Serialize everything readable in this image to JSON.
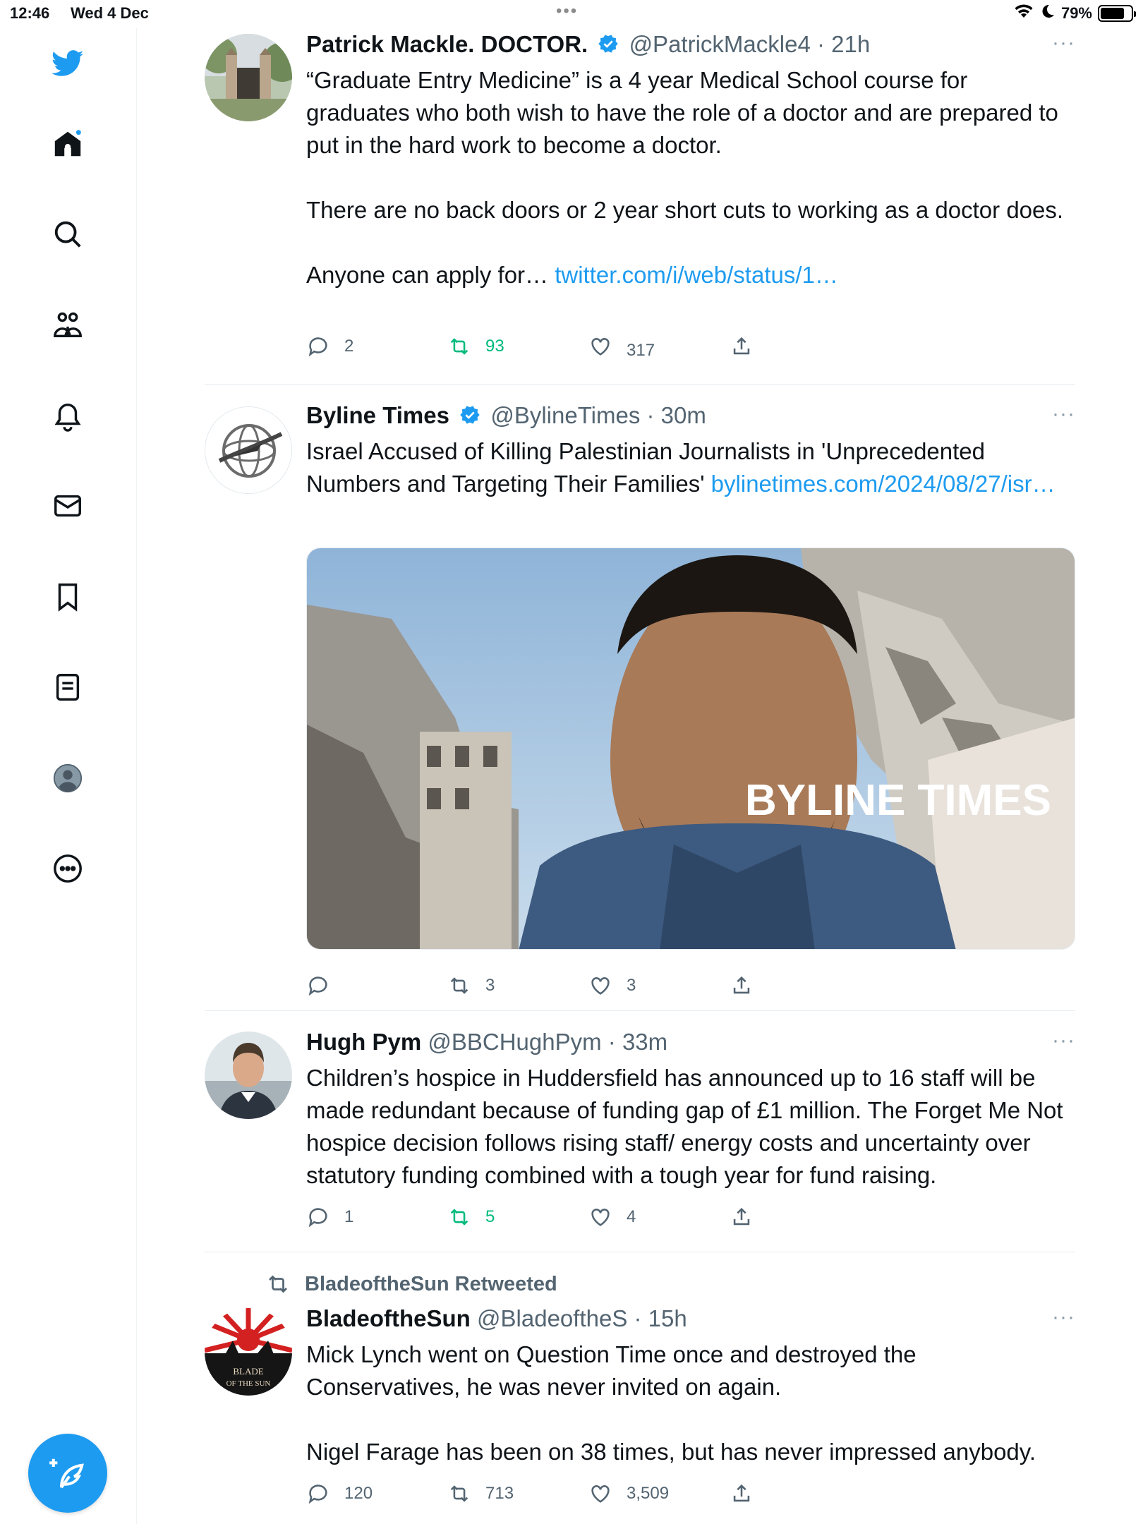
{
  "status_bar": {
    "time": "12:46",
    "date": "Wed 4 Dec",
    "battery": "79%",
    "battery_level": 0.79
  },
  "sidebar": {
    "icons": [
      "twitter-logo-icon",
      "home-icon",
      "search-icon",
      "communities-icon",
      "notifications-icon",
      "messages-icon",
      "bookmarks-icon",
      "lists-icon",
      "profile-icon",
      "more-icon"
    ],
    "compose_icon": "compose-tweet-icon",
    "accent": "#1d9bf0",
    "home_notification_dot": true
  },
  "tweets": [
    {
      "name": "Patrick Mackle. DOCTOR.",
      "verified": true,
      "handle": "@PatrickMackle4",
      "sep": "·",
      "time": "21h",
      "more": "···",
      "paragraphs": [
        "“Graduate Entry Medicine” is a 4 year Medical School course for graduates who both wish to have the role of a doctor and are prepared to put in the hard work to become a doctor.",
        "There are no back doors or 2 year short cuts to working as a doctor does.",
        "Anyone can apply for…"
      ],
      "link": "twitter.com/i/web/status/1…",
      "replies": "2",
      "retweets": "93",
      "likes": "317",
      "retweeted_by_me": true
    },
    {
      "name": "Byline Times",
      "verified": true,
      "handle": "@BylineTimes",
      "sep": "·",
      "time": "30m",
      "more": "···",
      "text": "Israel Accused of Killing Palestinian Journalists in 'Unprecedented Numbers and Targeting Their Families'",
      "link": "bylinetimes.com/2024/08/27/isr…",
      "media_watermark": "BYLINE TIMES",
      "replies": "",
      "retweets": "3",
      "likes": "3"
    },
    {
      "name": "Hugh Pym",
      "verified": false,
      "handle": "@BBCHughPym",
      "sep": "·",
      "time": "33m",
      "more": "···",
      "text": "Children’s hospice in Huddersfield has announced up to 16 staff will be made redundant because of funding gap of £1 million.  The Forget Me Not hospice decision follows rising staff/ energy costs and uncertainty over statutory funding combined with a tough year for fund raising.",
      "replies": "1",
      "retweets": "5",
      "likes": "4",
      "retweeted_by_me": true
    },
    {
      "retweet_context": "BladeoftheSun Retweeted",
      "name": "BladeoftheSun",
      "verified": false,
      "handle": "@BladeoftheS",
      "sep": "·",
      "time": "15h",
      "more": "···",
      "avatar_text": "BLADE OF THE SUN",
      "paragraphs": [
        "Mick Lynch went on Question Time once and destroyed the Conservatives, he was never invited on again.",
        "Nigel Farage has been on 38 times, but has never impressed anybody."
      ],
      "replies": "120",
      "retweets": "713",
      "likes": "3,509"
    }
  ]
}
